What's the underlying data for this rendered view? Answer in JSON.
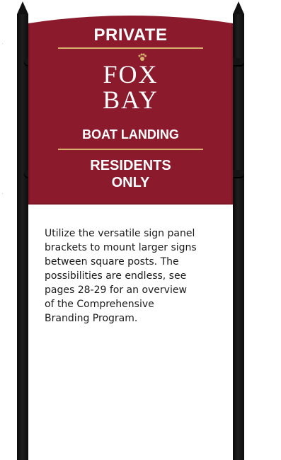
{
  "sign": {
    "header": "PRIVATE",
    "brand_line1": "FOX",
    "brand_line2": "BAY",
    "subtitle": "BOAT LANDING",
    "notice_line1": "RESIDENTS",
    "notice_line2": "ONLY",
    "emblem_icon": "fox-paw-icon"
  },
  "description": "Utilize the versatile sign panel\nbrackets to mount larger signs\nbetween square posts. The\npossibilities are endless, see\npages 28-29 for an overview\nof the  Comprehensive\nBranding Program.",
  "colors": {
    "panel": "#8a1a2c",
    "accent_gold": "#d8b06d",
    "post": "#111111",
    "background": "#ffffff"
  }
}
